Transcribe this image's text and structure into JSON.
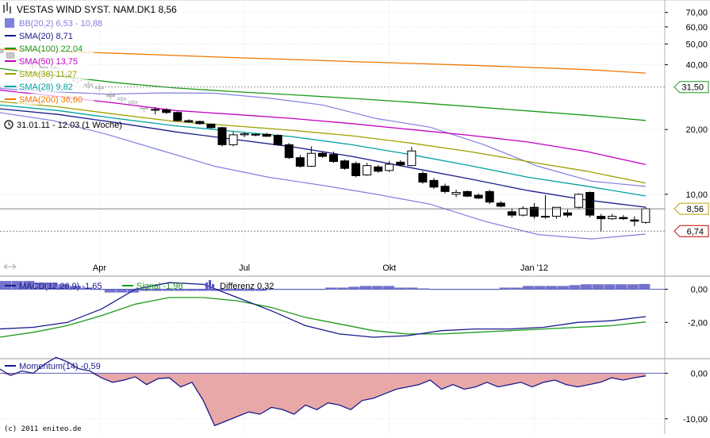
{
  "header": {
    "symbol_icon": "chart-icon",
    "title": "VESTAS WIND SYST. NAM.DK1 8,56"
  },
  "legend": [
    {
      "label": "BB(20,2) 6,53 - 10,88",
      "color": "#8080e0",
      "kind": "box"
    },
    {
      "label": "SMA(20) 8,71",
      "color": "#1a1a8c",
      "kind": "line"
    },
    {
      "label": "SMA(100) 22,04",
      "color": "#1a9a1a",
      "kind": "line"
    },
    {
      "label": "SMA(50) 13,75",
      "color": "#c000c0",
      "kind": "line"
    },
    {
      "label": "SMA(38) 11,27",
      "color": "#a0a000",
      "kind": "line"
    },
    {
      "label": "SMA(28) 9,82",
      "color": "#00a0a0",
      "kind": "line"
    },
    {
      "label": "SMA(200) 36,60",
      "color": "#f07800",
      "kind": "line"
    }
  ],
  "period": {
    "icon": "clock-icon",
    "label": "31.01.11 - 12.03 (1 Woche)"
  },
  "price_tags": [
    {
      "label": "31,50",
      "value": 31.5,
      "color": "#1a9a1a"
    },
    {
      "label": "8,56",
      "value": 8.56,
      "color": "#c0a000"
    },
    {
      "label": "6,74",
      "value": 6.74,
      "color": "#c00000"
    }
  ],
  "panels": {
    "macd": {
      "legend": [
        {
          "label": "MACD(12,26,9) -1,65",
          "color": "#1a1a8c",
          "kind": "line"
        },
        {
          "label": "Signal -1,98",
          "color": "#1a9a1a",
          "kind": "line"
        },
        {
          "label": "Differenz 0,32",
          "color": "#5050c0",
          "kind": "bars"
        }
      ]
    },
    "momentum": {
      "legend": [
        {
          "label": "Momentum(14) -0,59",
          "color": "#1a1a8c",
          "kind": "line"
        }
      ]
    }
  },
  "copyright": "(c) 2011 eniteo.de",
  "chart_data": [
    {
      "type": "candlestick",
      "scale": "log",
      "xlabel": "",
      "ylabel": "",
      "x_ticks": [
        "Apr",
        "Jul",
        "Okt",
        "Jan '12"
      ],
      "y_ticks": [
        "70,00",
        "60,00",
        "50,00",
        "40,00",
        "20,00",
        "10,00"
      ],
      "y_tick_values": [
        70,
        60,
        50,
        40,
        20,
        10
      ],
      "ylim": [
        6.0,
        80.0
      ],
      "weeks_total": 59,
      "candles": [
        {
          "o": 47.0,
          "h": 48.0,
          "l": 44.5,
          "c": 45.5
        },
        {
          "o": 45.5,
          "h": 46.0,
          "l": 42.5,
          "c": 43.0
        },
        {
          "o": 41.5,
          "h": 43.0,
          "l": 40.5,
          "c": 42.5
        },
        {
          "o": 39.5,
          "h": 41.0,
          "l": 38.5,
          "c": 40.0
        },
        {
          "o": 38.5,
          "h": 40.0,
          "l": 37.0,
          "c": 39.0
        },
        {
          "o": 37.5,
          "h": 39.5,
          "l": 36.5,
          "c": 38.5
        },
        {
          "o": 36.0,
          "h": 37.0,
          "l": 34.5,
          "c": 35.5
        },
        {
          "o": 33.5,
          "h": 35.0,
          "l": 32.5,
          "c": 34.5
        },
        {
          "o": 32.0,
          "h": 33.5,
          "l": 31.0,
          "c": 32.5
        },
        {
          "o": 31.0,
          "h": 32.5,
          "l": 30.0,
          "c": 31.5
        },
        {
          "o": 29.0,
          "h": 30.0,
          "l": 27.5,
          "c": 28.5
        },
        {
          "o": 27.5,
          "h": 28.5,
          "l": 26.0,
          "c": 28.0
        },
        {
          "o": 26.5,
          "h": 27.5,
          "l": 25.5,
          "c": 27.0
        },
        {
          "o": 25.0,
          "h": 25.8,
          "l": 24.0,
          "c": 25.2
        },
        {
          "o": 24.6,
          "h": 25.4,
          "l": 23.5,
          "c": 24.8
        },
        {
          "o": 24.7,
          "h": 25.1,
          "l": 23.6,
          "c": 24.0
        },
        {
          "o": 24.0,
          "h": 24.3,
          "l": 21.8,
          "c": 22.0
        },
        {
          "o": 22.0,
          "h": 22.3,
          "l": 21.5,
          "c": 21.7
        },
        {
          "o": 21.8,
          "h": 22.0,
          "l": 21.1,
          "c": 21.3
        },
        {
          "o": 21.2,
          "h": 21.3,
          "l": 20.2,
          "c": 20.4
        },
        {
          "o": 20.4,
          "h": 20.6,
          "l": 16.7,
          "c": 17.0
        },
        {
          "o": 17.0,
          "h": 19.5,
          "l": 16.7,
          "c": 18.9
        },
        {
          "o": 18.9,
          "h": 19.4,
          "l": 18.4,
          "c": 19.1
        },
        {
          "o": 18.9,
          "h": 19.2,
          "l": 18.6,
          "c": 19.0
        },
        {
          "o": 19.0,
          "h": 19.3,
          "l": 18.5,
          "c": 18.6
        },
        {
          "o": 18.8,
          "h": 19.0,
          "l": 16.8,
          "c": 17.0
        },
        {
          "o": 17.0,
          "h": 17.3,
          "l": 14.6,
          "c": 14.8
        },
        {
          "o": 14.8,
          "h": 15.2,
          "l": 13.3,
          "c": 13.5
        },
        {
          "o": 13.5,
          "h": 16.7,
          "l": 13.4,
          "c": 15.5
        },
        {
          "o": 15.5,
          "h": 15.8,
          "l": 14.8,
          "c": 15.0
        },
        {
          "o": 15.3,
          "h": 15.8,
          "l": 14.0,
          "c": 14.2
        },
        {
          "o": 14.3,
          "h": 14.5,
          "l": 13.0,
          "c": 13.2
        },
        {
          "o": 13.9,
          "h": 14.2,
          "l": 12.0,
          "c": 12.2
        },
        {
          "o": 12.3,
          "h": 14.0,
          "l": 12.2,
          "c": 13.6
        },
        {
          "o": 13.4,
          "h": 13.7,
          "l": 12.6,
          "c": 12.8
        },
        {
          "o": 12.9,
          "h": 14.3,
          "l": 12.7,
          "c": 13.8
        },
        {
          "o": 14.1,
          "h": 14.4,
          "l": 13.5,
          "c": 13.7
        },
        {
          "o": 13.6,
          "h": 16.6,
          "l": 13.5,
          "c": 15.9
        },
        {
          "o": 12.5,
          "h": 12.8,
          "l": 11.2,
          "c": 11.4
        },
        {
          "o": 11.6,
          "h": 11.9,
          "l": 10.6,
          "c": 10.8
        },
        {
          "o": 10.9,
          "h": 11.2,
          "l": 10.1,
          "c": 10.3
        },
        {
          "o": 10.0,
          "h": 10.5,
          "l": 9.7,
          "c": 10.2
        },
        {
          "o": 10.3,
          "h": 10.4,
          "l": 9.7,
          "c": 9.8
        },
        {
          "o": 9.9,
          "h": 10.1,
          "l": 9.5,
          "c": 9.6
        },
        {
          "o": 10.3,
          "h": 10.5,
          "l": 9.0,
          "c": 9.2
        },
        {
          "o": 9.1,
          "h": 9.3,
          "l": 8.7,
          "c": 8.8
        },
        {
          "o": 8.3,
          "h": 8.6,
          "l": 7.8,
          "c": 8.0
        },
        {
          "o": 8.0,
          "h": 8.8,
          "l": 7.9,
          "c": 8.6
        },
        {
          "o": 8.7,
          "h": 9.1,
          "l": 7.7,
          "c": 7.9
        },
        {
          "o": 7.9,
          "h": 9.9,
          "l": 7.7,
          "c": 7.9
        },
        {
          "o": 7.9,
          "h": 8.7,
          "l": 7.7,
          "c": 8.7
        },
        {
          "o": 8.2,
          "h": 8.5,
          "l": 7.8,
          "c": 8.0
        },
        {
          "o": 8.7,
          "h": 10.1,
          "l": 8.6,
          "c": 10.0
        },
        {
          "o": 10.2,
          "h": 10.3,
          "l": 7.8,
          "c": 8.0
        },
        {
          "o": 7.9,
          "h": 8.1,
          "l": 6.7,
          "c": 7.7
        },
        {
          "o": 7.7,
          "h": 8.1,
          "l": 7.6,
          "c": 7.9
        },
        {
          "o": 7.8,
          "h": 8.0,
          "l": 7.6,
          "c": 7.7
        },
        {
          "o": 7.6,
          "h": 7.9,
          "l": 7.1,
          "c": 7.5
        },
        {
          "o": 7.4,
          "h": 8.7,
          "l": 7.3,
          "c": 8.56
        }
      ],
      "series": [
        {
          "name": "SMA(200)",
          "color": "#f07800",
          "values": [
            47.2,
            46.2,
            45.2,
            44.2,
            43.2,
            42.3,
            41.4,
            40.6,
            39.8,
            38.9,
            38.0,
            36.6
          ]
        },
        {
          "name": "SMA(100)",
          "color": "#1a9a1a",
          "values": [
            38.5,
            35.5,
            33.0,
            31.2,
            30.0,
            29.0,
            27.9,
            26.8,
            25.6,
            24.4,
            23.3,
            22.04
          ]
        },
        {
          "name": "SMA(50)",
          "color": "#c000c0",
          "values": [
            30.5,
            28.5,
            26.5,
            24.5,
            23.5,
            22.5,
            21.3,
            20.0,
            18.8,
            17.5,
            15.8,
            13.75
          ]
        },
        {
          "name": "SMA(38)",
          "color": "#a0a000",
          "values": [
            27.0,
            25.5,
            23.5,
            21.8,
            20.8,
            19.8,
            18.7,
            17.3,
            15.8,
            14.2,
            12.8,
            11.27
          ]
        },
        {
          "name": "SMA(28)",
          "color": "#00a0a0",
          "values": [
            26.0,
            24.5,
            22.5,
            20.8,
            19.6,
            18.5,
            17.0,
            15.3,
            13.6,
            12.0,
            10.9,
            9.82
          ]
        },
        {
          "name": "SMA(20)",
          "color": "#1a1a8c",
          "values": [
            25.0,
            23.5,
            21.5,
            19.5,
            18.0,
            16.6,
            15.0,
            13.3,
            11.8,
            10.4,
            9.4,
            8.71
          ]
        },
        {
          "name": "BB upper",
          "color": "#8080e0",
          "values": [
            31.0,
            30.0,
            29.2,
            29.6,
            29.5,
            28.0,
            26.0,
            22.5,
            20.5,
            17.0,
            13.5,
            11.5,
            10.88
          ]
        },
        {
          "name": "BB lower",
          "color": "#8080e0",
          "values": [
            24.0,
            22.0,
            19.0,
            16.0,
            13.5,
            12.0,
            11.0,
            10.0,
            9.0,
            7.5,
            6.5,
            6.2,
            6.53
          ]
        }
      ]
    },
    {
      "type": "line",
      "title": "MACD(12,26,9)",
      "y_ticks": [
        "0,00",
        "-2,00"
      ],
      "y_tick_values": [
        0,
        -2
      ],
      "ylim": [
        -4.0,
        0.6
      ],
      "series": [
        {
          "name": "MACD(12,26,9)",
          "color": "#1a1a8c",
          "values": [
            -2.4,
            -2.3,
            -2.0,
            -1.2,
            0.0,
            0.4,
            0.3,
            -0.5,
            -1.3,
            -2.2,
            -2.7,
            -2.9,
            -2.8,
            -2.5,
            -2.4,
            -2.4,
            -2.3,
            -2.0,
            -1.9,
            -1.65
          ]
        },
        {
          "name": "Signal",
          "color": "#1a9a1a",
          "values": [
            -2.9,
            -2.6,
            -2.2,
            -1.6,
            -0.9,
            -0.5,
            -0.5,
            -0.7,
            -1.1,
            -1.7,
            -2.1,
            -2.5,
            -2.7,
            -2.7,
            -2.6,
            -2.5,
            -2.4,
            -2.3,
            -2.2,
            -1.98
          ]
        },
        {
          "name": "Differenz",
          "color": "#5050c0",
          "values": [
            0.5,
            0.5,
            0.5,
            0.4,
            0.4,
            0.3,
            0.2,
            0.1,
            0.0,
            -0.2,
            -0.2,
            -0.2,
            -0.1,
            -0.1,
            -0.1,
            -0.1,
            -0.1,
            -0.1,
            -0.1,
            -0.1,
            -0.1,
            -0.1,
            -0.1,
            0.0,
            0.0,
            0.0,
            0.0,
            0.0,
            0.1,
            0.1,
            0.15,
            0.2,
            0.2,
            0.2,
            0.1,
            0.1,
            0.05,
            0.0,
            0.0,
            0.0,
            0.0,
            0.0,
            0.0,
            0.1,
            0.1,
            0.2,
            0.2,
            0.2,
            0.2,
            0.25,
            0.3,
            0.3,
            0.3,
            0.3,
            0.3,
            0.32
          ]
        }
      ]
    },
    {
      "type": "area",
      "title": "Momentum(14)",
      "y_ticks": [
        "0,00",
        "-10,00"
      ],
      "y_tick_values": [
        0,
        -10
      ],
      "ylim": [
        -13.0,
        2.5
      ],
      "series": [
        {
          "name": "Momentum(14)",
          "color": "#1a1a8c",
          "fill": "#e8a8a8",
          "values": [
            1.0,
            -0.5,
            0.5,
            0.0,
            2.0,
            3.5,
            2.5,
            1.0,
            0.5,
            -1.0,
            -2.0,
            -1.5,
            -0.8,
            -2.5,
            -1.2,
            -1.0,
            -3.0,
            -2.0,
            -6.0,
            -11.5,
            -10.5,
            -9.5,
            -8.5,
            -9.0,
            -7.5,
            -8.0,
            -9.0,
            -7.0,
            -8.0,
            -6.5,
            -7.0,
            -8.0,
            -6.0,
            -5.5,
            -4.5,
            -3.5,
            -3.0,
            -2.5,
            -1.5,
            -3.5,
            -2.5,
            -3.5,
            -3.0,
            -2.0,
            -3.0,
            -2.5,
            -2.0,
            -3.0,
            -2.0,
            -1.5,
            -2.5,
            -3.0,
            -2.5,
            -2.0,
            -1.0,
            -1.5,
            -1.0,
            -0.59
          ]
        }
      ]
    }
  ]
}
